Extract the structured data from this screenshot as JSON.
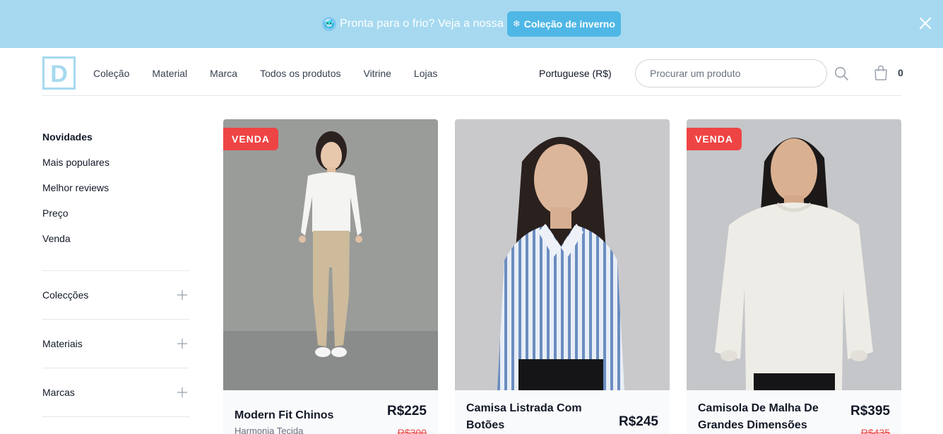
{
  "banner": {
    "emoji": "🥶",
    "text": "Pronta para o frio? Veja a nossa",
    "cta_icon": "❄",
    "cta_label": "Coleção de inverno",
    "close_icon": "close-icon"
  },
  "header": {
    "logo_letter": "D",
    "nav": [
      "Coleção",
      "Material",
      "Marca",
      "Todos os produtos",
      "Vitrine",
      "Lojas"
    ],
    "language": "Portuguese (R$)",
    "search_placeholder": "Procurar um produto",
    "cart_count": "0"
  },
  "sidebar": {
    "quick_links": [
      "Novidades",
      "Mais populares",
      "Melhor reviews",
      "Preço",
      "Venda"
    ],
    "filters": [
      "Colecções",
      "Materiais",
      "Marcas"
    ]
  },
  "products": [
    {
      "name": "Modern Fit Chinos",
      "subtitle": "Harmonia Tecida",
      "price": "R$225",
      "old_price": "R$300",
      "badge": "VENDA"
    },
    {
      "name": "Camisa Listrada Com Botões",
      "price": "R$245"
    },
    {
      "name": "Camisola De Malha De Grandes Dimensões",
      "price": "R$395",
      "old_price": "R$435",
      "badge": "VENDA"
    }
  ],
  "colors": {
    "banner_bg": "#a6d9f0",
    "banner_cta_bg": "#4fb7e6",
    "sale_red": "#ef4444",
    "logo_blue": "#a6d9f0"
  }
}
